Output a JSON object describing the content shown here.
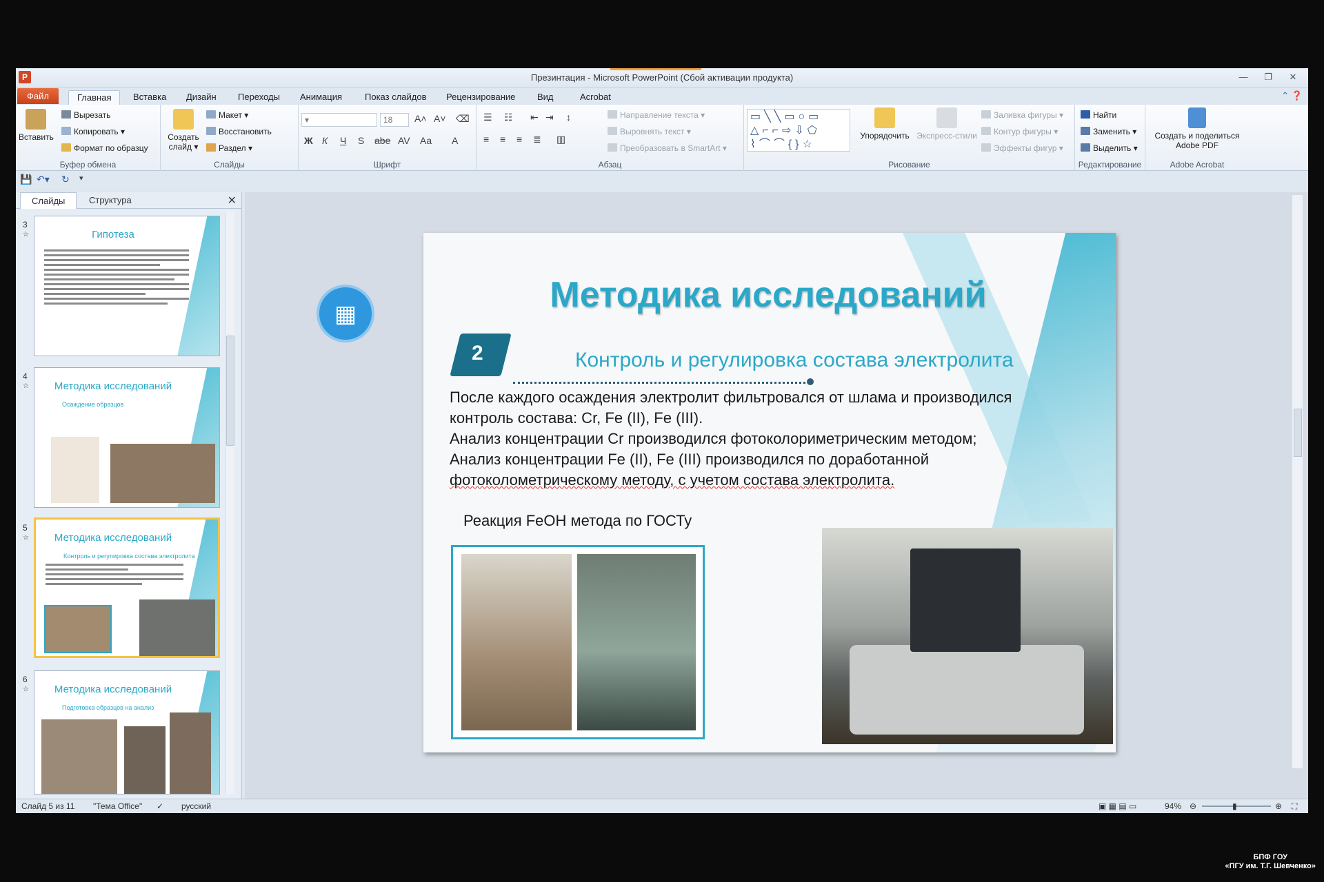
{
  "window": {
    "title": "Презинтация  -  Microsoft PowerPoint (Сбой активации продукта)",
    "app_logo": "P"
  },
  "tabs": {
    "file": "Файл",
    "items": [
      "Главная",
      "Вставка",
      "Дизайн",
      "Переходы",
      "Анимация",
      "Показ слайдов",
      "Рецензирование",
      "Вид",
      "Acrobat"
    ]
  },
  "ribbon": {
    "clipboard": {
      "label": "Буфер обмена",
      "paste": "Вставить",
      "cut": "Вырезать",
      "copy": "Копировать",
      "format_painter": "Формат по образцу"
    },
    "slides": {
      "label": "Слайды",
      "new_slide_line1": "Создать",
      "new_slide_line2": "слайд",
      "layout": "Макет",
      "reset": "Восстановить",
      "section": "Раздел"
    },
    "font": {
      "label": "Шрифт",
      "size": "18",
      "bold": "Ж",
      "italic": "К",
      "underline": "Ч",
      "shadow": "S",
      "strike": "abe",
      "case": "Aa"
    },
    "paragraph": {
      "label": "Абзац",
      "text_direction": "Направление текста",
      "align_text": "Выровнять текст",
      "smartart": "Преобразовать в SmartArt"
    },
    "drawing": {
      "label": "Рисование",
      "arrange": "Упорядочить",
      "quick_styles": "Экспресс-стили",
      "fill": "Заливка фигуры",
      "outline": "Контур фигуры",
      "effects": "Эффекты фигур"
    },
    "editing": {
      "label": "Редактирование",
      "find": "Найти",
      "replace": "Заменить",
      "select": "Выделить"
    },
    "acrobat": {
      "label": "Adobe Acrobat",
      "create_line1": "Создать и поделиться",
      "create_line2": "Adobe PDF"
    }
  },
  "panel": {
    "tab_slides": "Слайды",
    "tab_outline": "Структура",
    "thumbs": [
      {
        "num": "3",
        "title": "Гипотеза",
        "sub": ""
      },
      {
        "num": "4",
        "title": "Методика исследований",
        "sub": "Осаждение образцов"
      },
      {
        "num": "5",
        "title": "Методика исследований",
        "sub": "Контроль и регулировка состава электролита"
      },
      {
        "num": "6",
        "title": "Методика исследований",
        "sub": "Подготовка образцов на анализ"
      }
    ]
  },
  "slide": {
    "title": "Методика исследований",
    "number": "2",
    "subtitle": "Контроль и регулировка состава  электролита",
    "body": [
      "После каждого осаждения электролит фильтровался от шлама и производился",
      "контроль состава: Cr, Fe (II), Fe (III).",
      "Анализ концентрации Cr производился фотоколориметрическим методом;",
      "Анализ концентрации Fe (II), Fe (III) производился по доработанной",
      "фотоколометрическому методу, с учетом состава электролита."
    ],
    "caption": "Реакция FeOH метода по ГОСТу"
  },
  "status": {
    "slide_info": "Слайд 5 из 11",
    "theme": "\"Тема Office\"",
    "language": "русский",
    "zoom": "94%"
  },
  "watermark": {
    "line1": "БПФ ГОУ",
    "line2": "«ПГУ им. Т.Г. Шевченко»"
  },
  "colors": {
    "accent_teal": "#2ba8c8",
    "file_tab": "#d24726"
  }
}
